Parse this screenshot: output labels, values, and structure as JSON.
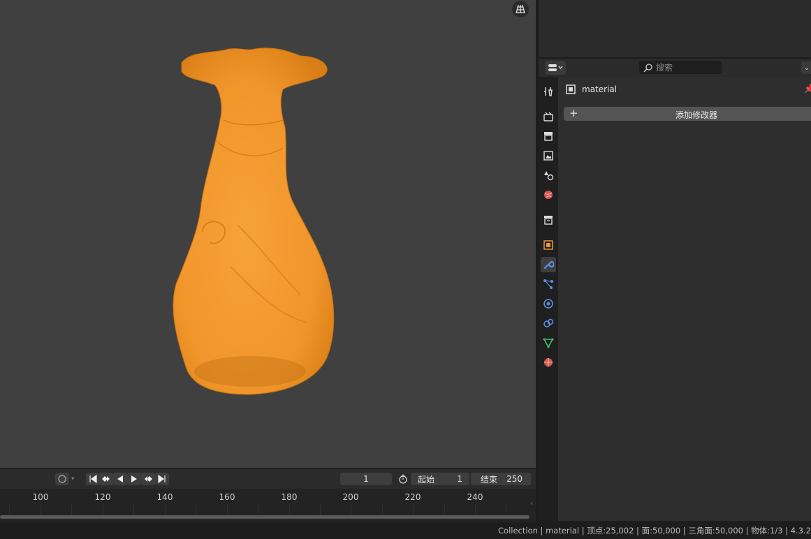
{
  "timeline": {
    "current_frame": "1",
    "start_label": "起始",
    "start_value": "1",
    "end_label": "结束",
    "end_value": "250",
    "ruler_ticks": [
      "100",
      "120",
      "140",
      "160",
      "180",
      "200",
      "220",
      "240"
    ]
  },
  "properties": {
    "search_placeholder": "搜索",
    "object_name": "material",
    "add_modifier_label": "添加修改器",
    "tabs": [
      "tool-icon",
      "render-icon",
      "output-icon",
      "view-layer-icon",
      "scene-icon",
      "world-icon",
      "collection-icon",
      "object-icon",
      "modifier-icon",
      "particles-icon",
      "physics-icon",
      "constraints-icon",
      "data-icon",
      "material-icon"
    ],
    "active_tab": "modifier-icon"
  },
  "statusbar": {
    "text": "Collection | material | 顶点:25,002 | 面:50,000 | 三角面:50,000 | 物体:1/3 | 4.3.2"
  },
  "colors": {
    "vase": "#f59a2a",
    "active_tab": "#5e8fe0"
  }
}
